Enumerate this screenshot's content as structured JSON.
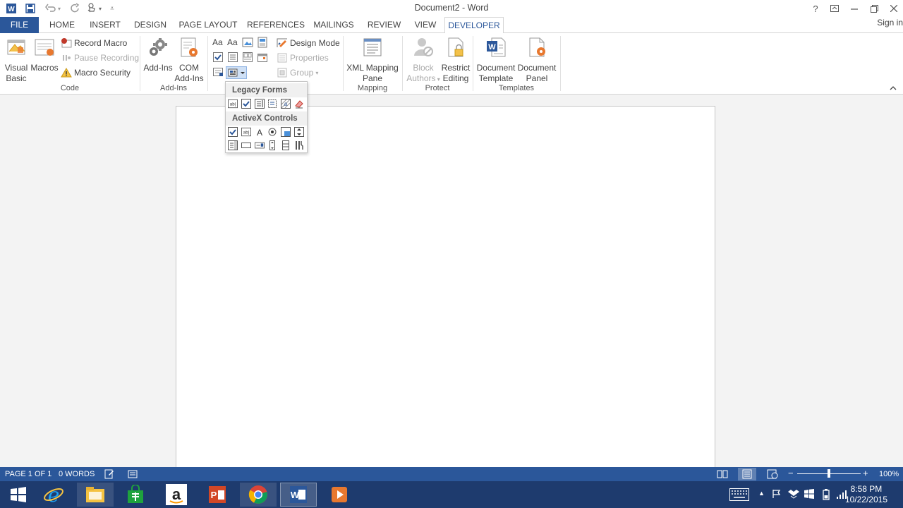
{
  "title_bar": {
    "document_title": "Document2 - Word",
    "help_label": "?",
    "quick_access": [
      "word-logo-icon",
      "save-icon",
      "undo-icon",
      "redo-icon",
      "touch-mode-icon",
      "customize-qat-icon"
    ]
  },
  "tabs": [
    {
      "label": "FILE"
    },
    {
      "label": "HOME"
    },
    {
      "label": "INSERT"
    },
    {
      "label": "DESIGN"
    },
    {
      "label": "PAGE LAYOUT"
    },
    {
      "label": "REFERENCES"
    },
    {
      "label": "MAILINGS"
    },
    {
      "label": "REVIEW"
    },
    {
      "label": "VIEW"
    },
    {
      "label": "DEVELOPER"
    }
  ],
  "sign_in": "Sign in",
  "ribbon": {
    "code": {
      "group_label": "Code",
      "visual_basic_line1": "Visual",
      "visual_basic_line2": "Basic",
      "macros": "Macros",
      "record_macro": "Record Macro",
      "pause_recording": "Pause Recording",
      "macro_security": "Macro Security"
    },
    "addins": {
      "group_label": "Add-Ins",
      "addins": "Add-Ins",
      "com_line1": "COM",
      "com_line2": "Add-Ins"
    },
    "controls": {
      "design_mode": "Design Mode",
      "properties": "Properties",
      "group": "Group"
    },
    "mapping": {
      "group_label": "Mapping",
      "xml_line1": "XML Mapping",
      "xml_line2": "Pane"
    },
    "protect": {
      "group_label": "Protect",
      "block_line1": "Block",
      "block_line2": "Authors",
      "restrict_line1": "Restrict",
      "restrict_line2": "Editing"
    },
    "templates": {
      "group_label": "Templates",
      "doc_template_line1": "Document",
      "doc_template_line2": "Template",
      "doc_panel_line1": "Document",
      "doc_panel_line2": "Panel"
    },
    "collapse_icon": "chevron-up-icon"
  },
  "dropdown": {
    "legacy_header": "Legacy Forms",
    "activex_header": "ActiveX Controls"
  },
  "status_bar": {
    "page": "PAGE 1 OF 1",
    "words": "0 WORDS",
    "zoom": "100%",
    "zoom_level": 1.0
  },
  "taskbar": {
    "apps": [
      "windows-start-icon",
      "internet-explorer-icon",
      "file-explorer-icon",
      "store-icon",
      "amazon-icon",
      "powerpoint-icon",
      "chrome-icon",
      "word-icon",
      "media-player-icon"
    ],
    "time": "8:58 PM",
    "date": "10/22/2015"
  },
  "colors": {
    "accent": "#2b579a",
    "taskbar": "#1e3b6e",
    "macro_red": "#c0392b",
    "orange": "#e8782f"
  }
}
